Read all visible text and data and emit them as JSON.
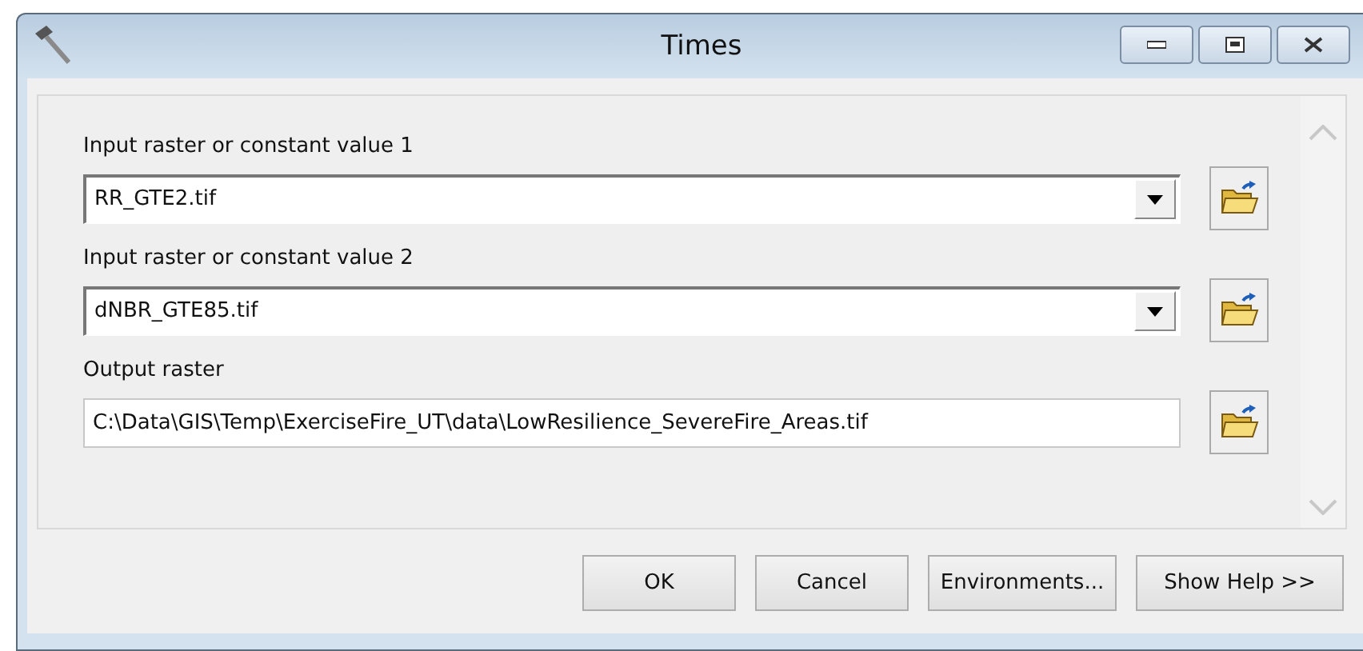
{
  "window": {
    "title": "Times"
  },
  "parameters": [
    {
      "label": "Input raster or constant value 1",
      "kind": "combo",
      "value": "RR_GTE2.tif"
    },
    {
      "label": "Input raster or constant value 2",
      "kind": "combo",
      "value": "dNBR_GTE85.tif"
    },
    {
      "label": "Output raster",
      "kind": "text",
      "value": "C:\\Data\\GIS\\Temp\\ExerciseFire_UT\\data\\LowResilience_SevereFire_Areas.tif"
    }
  ],
  "buttons": [
    "OK",
    "Cancel",
    "Environments...",
    "Show Help >>"
  ]
}
